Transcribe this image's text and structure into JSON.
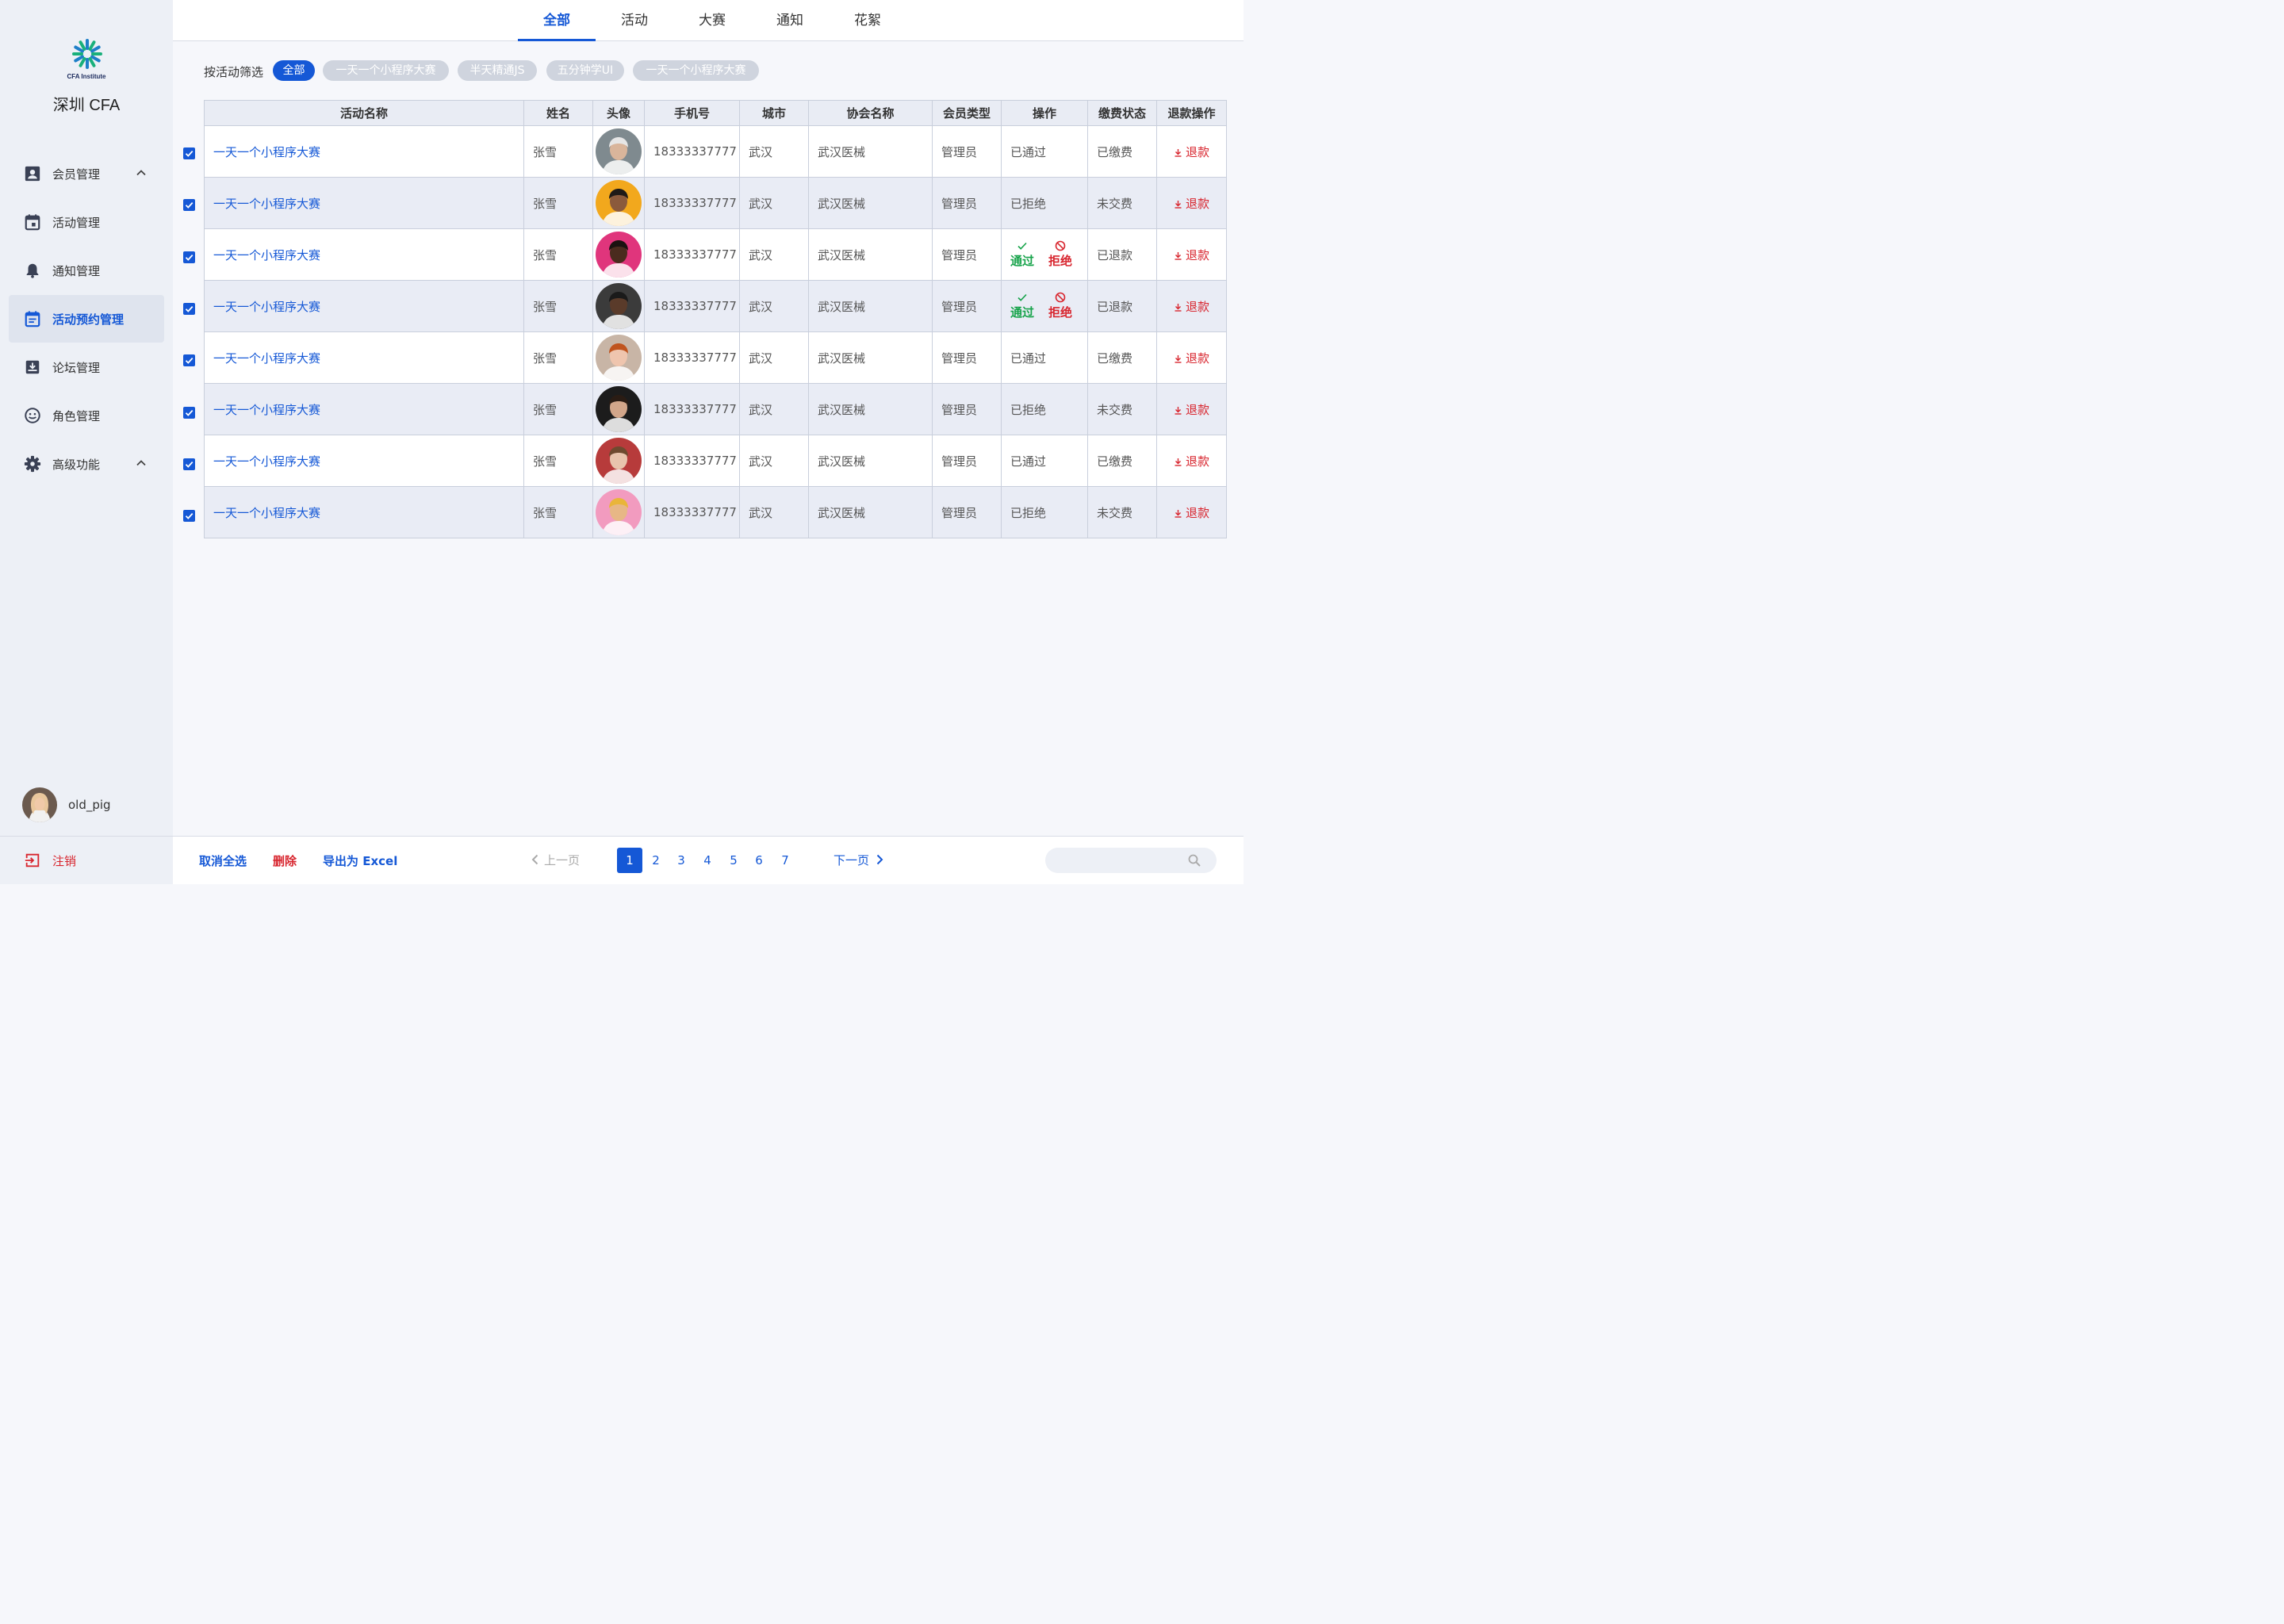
{
  "app": {
    "logo_text": "CFA Institute",
    "brand": "深圳 CFA"
  },
  "sidebar": {
    "items": [
      {
        "label": "会员管理",
        "icon": "user-card-icon",
        "expandable": true
      },
      {
        "label": "活动管理",
        "icon": "calendar-icon"
      },
      {
        "label": "通知管理",
        "icon": "bell-icon"
      },
      {
        "label": "活动预约管理",
        "icon": "calendar-list-icon",
        "active": true
      },
      {
        "label": "论坛管理",
        "icon": "inbox-icon"
      },
      {
        "label": "角色管理",
        "icon": "smiley-icon"
      },
      {
        "label": "高级功能",
        "icon": "gear-icon",
        "expandable": true
      }
    ],
    "user": {
      "name": "old_pig"
    },
    "logout": "注销"
  },
  "tabs": [
    {
      "label": "全部",
      "active": true
    },
    {
      "label": "活动"
    },
    {
      "label": "大赛"
    },
    {
      "label": "通知"
    },
    {
      "label": "花絮"
    }
  ],
  "filter": {
    "label": "按活动筛选",
    "chips": [
      {
        "label": "全部",
        "active": true
      },
      {
        "label": "一天一个小程序大赛"
      },
      {
        "label": "半天精通JS"
      },
      {
        "label": "五分钟学UI"
      },
      {
        "label": "一天一个小程序大赛"
      }
    ]
  },
  "table": {
    "headers": [
      "活动名称",
      "姓名",
      "头像",
      "手机号",
      "城市",
      "协会名称",
      "会员类型",
      "操作",
      "缴费状态",
      "退款操作"
    ],
    "rows": [
      {
        "checked": true,
        "activity": "一天一个小程序大赛",
        "name": "张雪",
        "phone": "18333337777",
        "city": "武汉",
        "assoc": "武汉医械",
        "member_type": "管理员",
        "op": "已通过",
        "pay": "已缴费",
        "refund": "退款"
      },
      {
        "checked": true,
        "activity": "一天一个小程序大赛",
        "name": "张雪",
        "phone": "18333337777",
        "city": "武汉",
        "assoc": "武汉医械",
        "member_type": "管理员",
        "op": "已拒绝",
        "pay": "未交费",
        "refund": "退款"
      },
      {
        "checked": true,
        "activity": "一天一个小程序大赛",
        "name": "张雪",
        "phone": "18333337777",
        "city": "武汉",
        "assoc": "武汉医械",
        "member_type": "管理员",
        "op_pass": "通过",
        "op_reject": "拒绝",
        "pay": "已退款",
        "refund": "退款"
      },
      {
        "checked": true,
        "activity": "一天一个小程序大赛",
        "name": "张雪",
        "phone": "18333337777",
        "city": "武汉",
        "assoc": "武汉医械",
        "member_type": "管理员",
        "op_pass": "通过",
        "op_reject": "拒绝",
        "pay": "已退款",
        "refund": "退款"
      },
      {
        "checked": true,
        "activity": "一天一个小程序大赛",
        "name": "张雪",
        "phone": "18333337777",
        "city": "武汉",
        "assoc": "武汉医械",
        "member_type": "管理员",
        "op": "已通过",
        "pay": "已缴费",
        "refund": "退款"
      },
      {
        "checked": true,
        "activity": "一天一个小程序大赛",
        "name": "张雪",
        "phone": "18333337777",
        "city": "武汉",
        "assoc": "武汉医械",
        "member_type": "管理员",
        "op": "已拒绝",
        "pay": "未交费",
        "refund": "退款"
      },
      {
        "checked": true,
        "activity": "一天一个小程序大赛",
        "name": "张雪",
        "phone": "18333337777",
        "city": "武汉",
        "assoc": "武汉医械",
        "member_type": "管理员",
        "op": "已通过",
        "pay": "已缴费",
        "refund": "退款"
      },
      {
        "checked": true,
        "activity": "一天一个小程序大赛",
        "name": "张雪",
        "phone": "18333337777",
        "city": "武汉",
        "assoc": "武汉医械",
        "member_type": "管理员",
        "op": "已拒绝",
        "pay": "未交费",
        "refund": "退款"
      }
    ]
  },
  "footer": {
    "deselect_all": "取消全选",
    "delete": "删除",
    "export": "导出为 Excel",
    "prev": "上一页",
    "next": "下一页",
    "pages": [
      "1",
      "2",
      "3",
      "4",
      "5",
      "6",
      "7"
    ],
    "current_page": "1",
    "search_placeholder": ""
  },
  "colors": {
    "primary": "#1558d6",
    "danger": "#d8262f",
    "success": "#16a34a"
  }
}
